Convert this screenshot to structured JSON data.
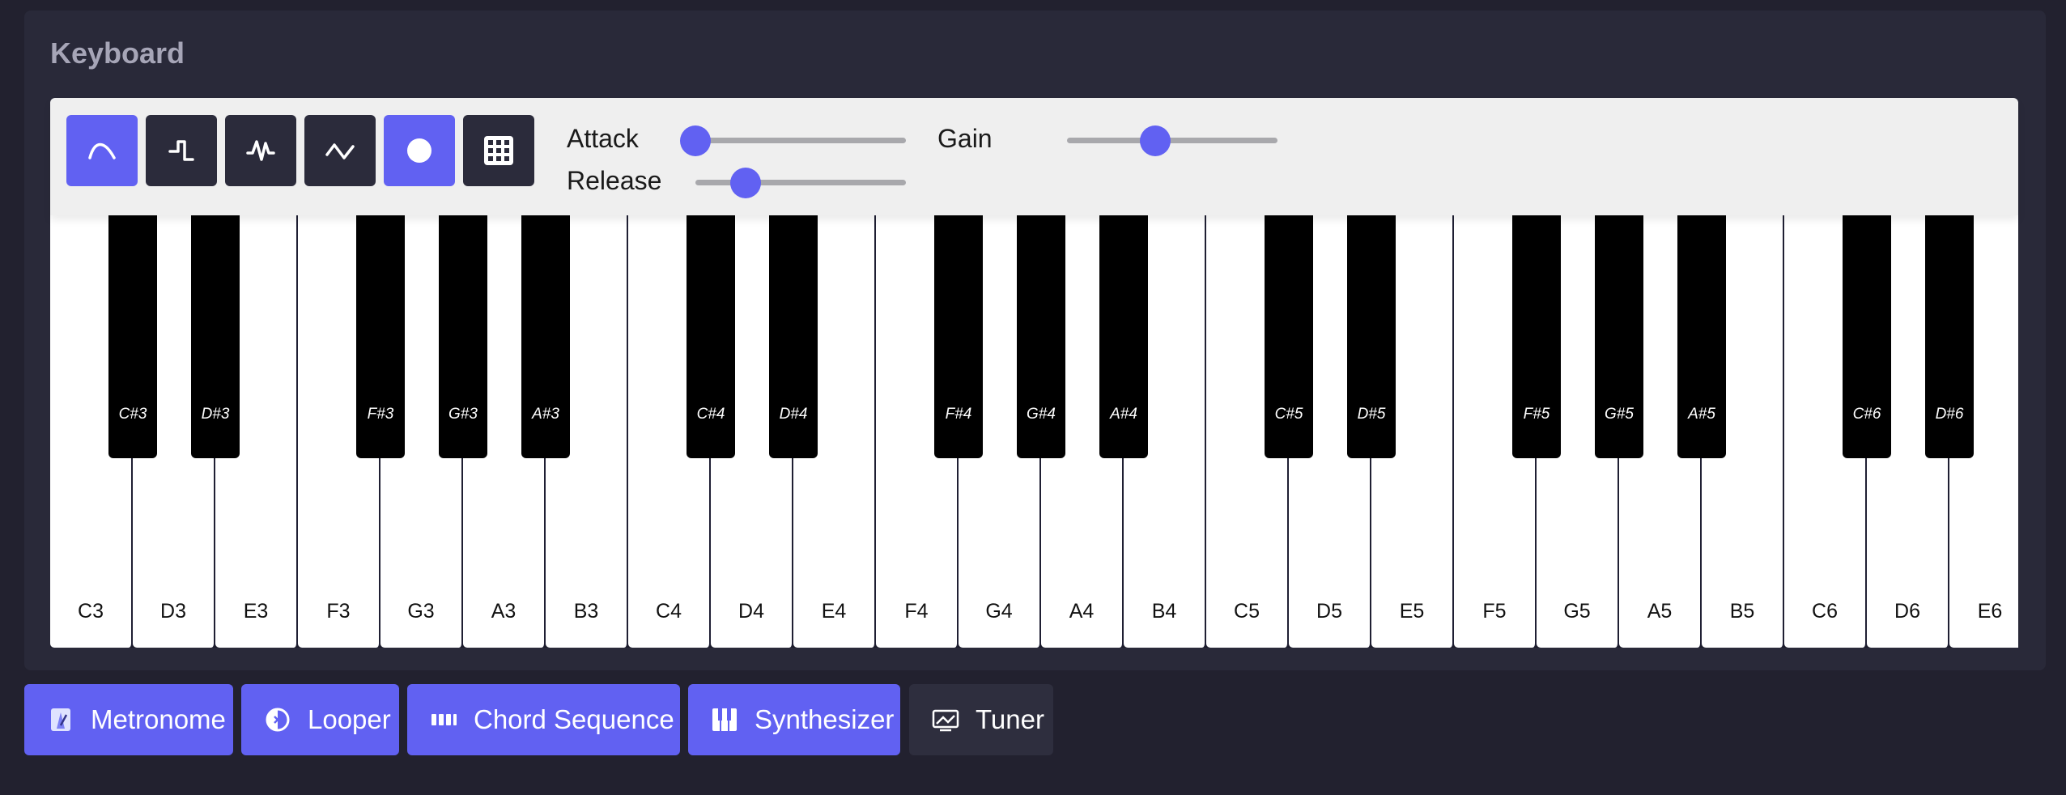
{
  "panel": {
    "title": "Keyboard"
  },
  "toolbar": {
    "waveforms": [
      {
        "name": "sine",
        "icon": "sine-wave-icon",
        "active": true
      },
      {
        "name": "square",
        "icon": "square-wave-icon",
        "active": false
      },
      {
        "name": "sawtooth",
        "icon": "sawtooth-wave-icon",
        "active": false
      },
      {
        "name": "triangle",
        "icon": "triangle-wave-icon",
        "active": false
      },
      {
        "name": "record",
        "icon": "record-icon",
        "active": true
      },
      {
        "name": "grid",
        "icon": "grid-icon",
        "active": false
      }
    ],
    "attack": {
      "label": "Attack",
      "value": 0.0
    },
    "release": {
      "label": "Release",
      "value": 0.24
    },
    "gain": {
      "label": "Gain",
      "value": 0.42
    }
  },
  "keys": {
    "white": [
      "C3",
      "D3",
      "E3",
      "F3",
      "G3",
      "A3",
      "B3",
      "C4",
      "D4",
      "E4",
      "F4",
      "G4",
      "A4",
      "B4",
      "C5",
      "D5",
      "E5",
      "F5",
      "G5",
      "A5",
      "B5",
      "C6",
      "D6",
      "E6"
    ],
    "black": [
      "C#3",
      "D#3",
      "F#3",
      "G#3",
      "A#3",
      "C#4",
      "D#4",
      "F#4",
      "G#4",
      "A#4",
      "C#5",
      "D#5",
      "F#5",
      "G#5",
      "A#5",
      "C#6",
      "D#6"
    ]
  },
  "tabs": [
    {
      "label": "Metronome",
      "icon": "metronome-icon",
      "active": true
    },
    {
      "label": "Looper",
      "icon": "looper-icon",
      "active": true
    },
    {
      "label": "Chord Sequence",
      "icon": "chord-sequence-icon",
      "active": true
    },
    {
      "label": "Synthesizer",
      "icon": "synthesizer-icon",
      "active": true
    },
    {
      "label": "Tuner",
      "icon": "tuner-icon",
      "active": false
    }
  ],
  "colors": {
    "accent": "#6161f2",
    "background": "#22212f",
    "panel": "#292939",
    "toolbar": "#efefef"
  }
}
